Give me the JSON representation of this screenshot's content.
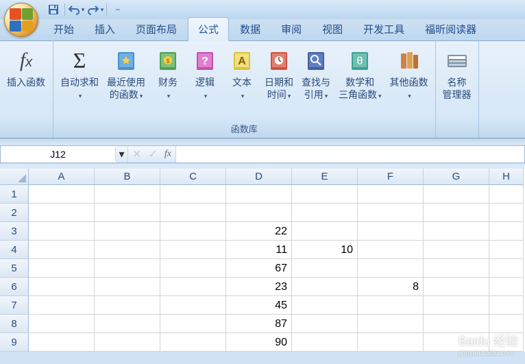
{
  "qat": {
    "save": "保存",
    "undo": "撤销",
    "redo": "重做"
  },
  "tabs": [
    "开始",
    "插入",
    "页面布局",
    "公式",
    "数据",
    "审阅",
    "视图",
    "开发工具",
    "福昕阅读器"
  ],
  "active_tab_index": 3,
  "ribbon": {
    "insert_fn": "插入函数",
    "autosum": "自动求和",
    "recent": "最近使用\n的函数",
    "financial": "财务",
    "logical": "逻辑",
    "text": "文本",
    "datetime": "日期和\n时间",
    "lookup": "查找与\n引用",
    "math": "数学和\n三角函数",
    "more": "其他函数",
    "name_mgr": "名称\n管理器",
    "group_label": "函数库"
  },
  "formula_bar": {
    "name_box": "J12",
    "fx": "fx",
    "value": ""
  },
  "columns": [
    "A",
    "B",
    "C",
    "D",
    "E",
    "F",
    "G",
    "H"
  ],
  "rows": [
    {
      "n": 1,
      "cells": [
        "",
        "",
        "",
        "",
        "",
        "",
        "",
        ""
      ]
    },
    {
      "n": 2,
      "cells": [
        "",
        "",
        "",
        "",
        "",
        "",
        "",
        ""
      ]
    },
    {
      "n": 3,
      "cells": [
        "",
        "",
        "",
        "22",
        "",
        "",
        "",
        ""
      ]
    },
    {
      "n": 4,
      "cells": [
        "",
        "",
        "",
        "11",
        "10",
        "",
        "",
        ""
      ]
    },
    {
      "n": 5,
      "cells": [
        "",
        "",
        "",
        "67",
        "",
        "",
        "",
        ""
      ]
    },
    {
      "n": 6,
      "cells": [
        "",
        "",
        "",
        "23",
        "",
        "8",
        "",
        ""
      ]
    },
    {
      "n": 7,
      "cells": [
        "",
        "",
        "",
        "45",
        "",
        "",
        "",
        ""
      ]
    },
    {
      "n": 8,
      "cells": [
        "",
        "",
        "",
        "87",
        "",
        "",
        "",
        ""
      ]
    },
    {
      "n": 9,
      "cells": [
        "",
        "",
        "",
        "90",
        "",
        "",
        "",
        ""
      ]
    }
  ],
  "watermark": {
    "brand": "Baidu 经验",
    "sub": "jingyan.baidu.com"
  }
}
